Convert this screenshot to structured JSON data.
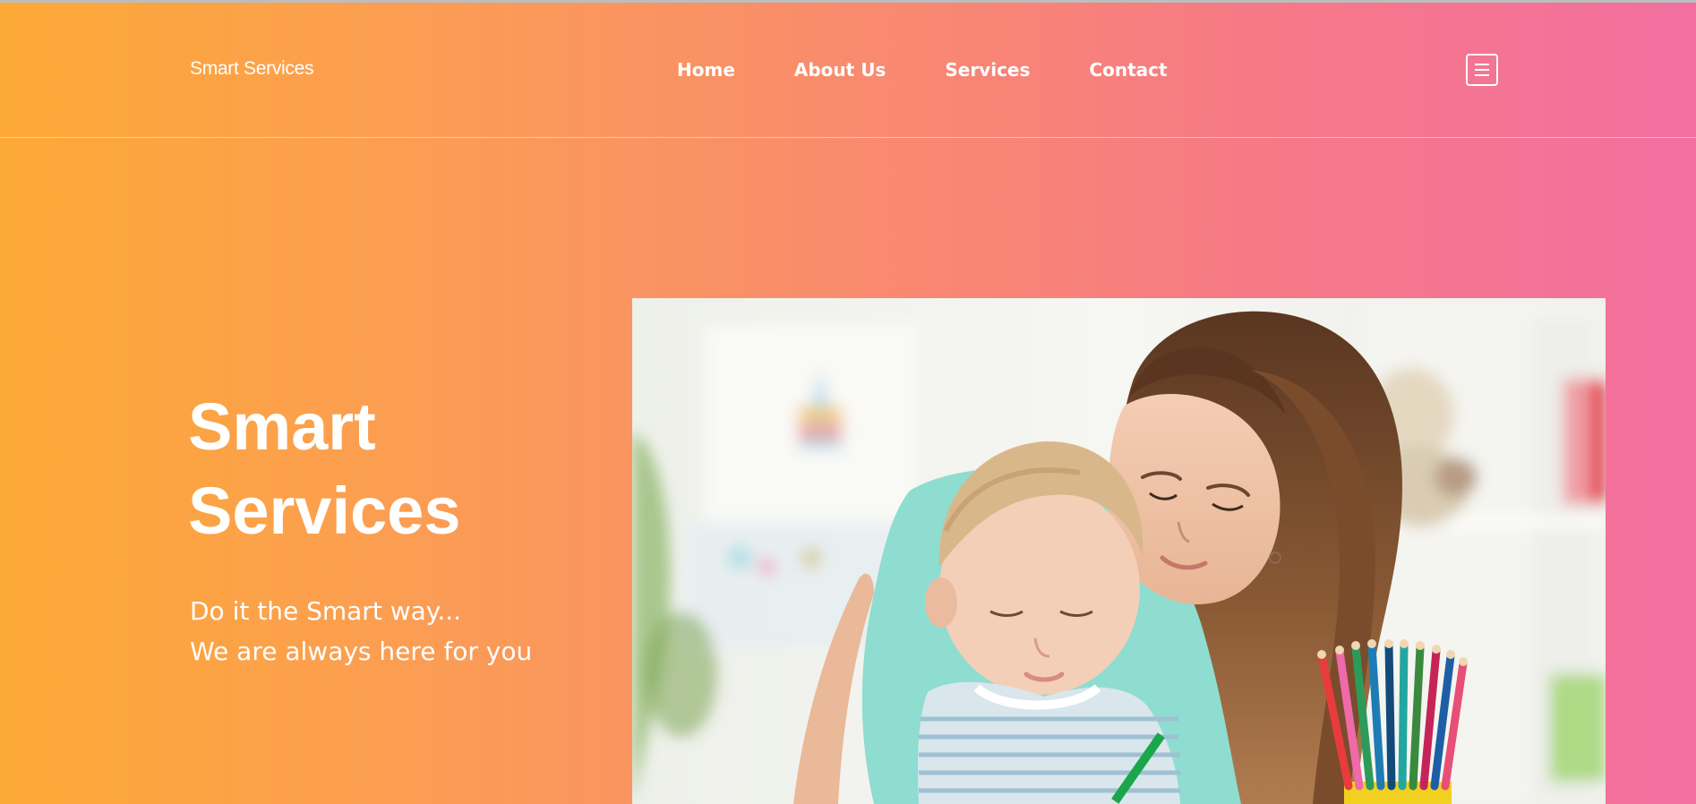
{
  "brand": {
    "name": "Smart Services"
  },
  "nav": {
    "items": [
      {
        "label": "Home"
      },
      {
        "label": "About Us"
      },
      {
        "label": "Services"
      },
      {
        "label": "Contact"
      }
    ],
    "menu_icon": "hamburger-icon"
  },
  "hero": {
    "title_line1": "Smart",
    "title_line2": "Services",
    "subtitle_line1": "Do it the Smart way...",
    "subtitle_line2": "We are always here for you",
    "image_subject": "mother-and-child-drawing-photo"
  },
  "colors": {
    "gradient_start": "#fda936",
    "gradient_end": "#f26fa0",
    "text": "#ffffff"
  }
}
